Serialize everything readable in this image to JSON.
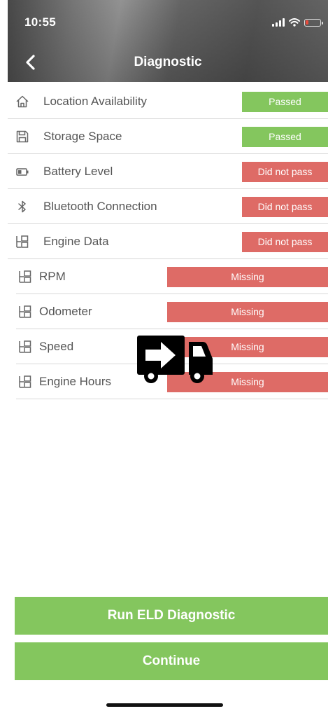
{
  "status_bar": {
    "time": "10:55"
  },
  "header": {
    "title": "Diagnostic"
  },
  "rows": [
    {
      "label": "Location Availability",
      "status": "Passed",
      "kind": "passed",
      "icon": "home-icon"
    },
    {
      "label": "Storage Space",
      "status": "Passed",
      "kind": "passed",
      "icon": "storage-icon"
    },
    {
      "label": "Battery Level",
      "status": "Did not pass",
      "kind": "fail",
      "icon": "battery-icon"
    },
    {
      "label": "Bluetooth Connection",
      "status": "Did not pass",
      "kind": "fail",
      "icon": "bluetooth-icon"
    },
    {
      "label": "Engine Data",
      "status": "Did not pass",
      "kind": "fail",
      "icon": "engine-data-icon"
    },
    {
      "label": "RPM",
      "status": "Missing",
      "kind": "fail",
      "icon": "engine-data-icon"
    },
    {
      "label": "Odometer",
      "status": "Missing",
      "kind": "fail",
      "icon": "engine-data-icon"
    },
    {
      "label": "Speed",
      "status": "Missing",
      "kind": "fail",
      "icon": "engine-data-icon"
    },
    {
      "label": "Engine Hours",
      "status": "Missing",
      "kind": "fail",
      "icon": "engine-data-icon"
    }
  ],
  "overlay": {
    "icon": "truck-arrow-icon"
  },
  "buttons": {
    "run": "Run ELD Diagnostic",
    "continue": "Continue"
  },
  "colors": {
    "passed": "#84c65e",
    "fail": "#de6b66"
  }
}
